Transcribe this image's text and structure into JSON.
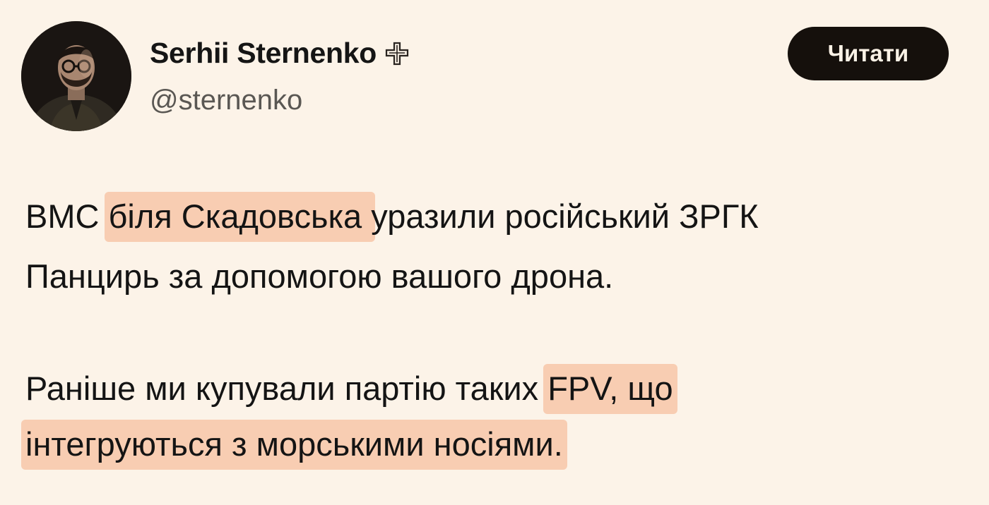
{
  "author": {
    "name": "Serhii Sternenko",
    "handle": "@sternenko",
    "badge_icon": "orthodox-cross-icon",
    "avatar_icon": "profile-photo"
  },
  "follow_button": {
    "label": "Читати"
  },
  "tweet": {
    "line1": {
      "before": "ВМС ",
      "highlight": "біля Скадовська ",
      "after": "уразили російський ЗРГК"
    },
    "line2": {
      "text": "Панцирь за допомогою вашого дрона."
    },
    "line3": {
      "before": "Раніше ми купували партію таких ",
      "highlight": "FPV, що"
    },
    "line4": {
      "highlight": "інтегруються з морськими носіями."
    }
  },
  "colors": {
    "background": "#fcf3e8",
    "highlight": "#f8cdb2",
    "button_bg": "#15100c",
    "button_text": "#fbf2e6",
    "handle_text": "#5a5753"
  }
}
